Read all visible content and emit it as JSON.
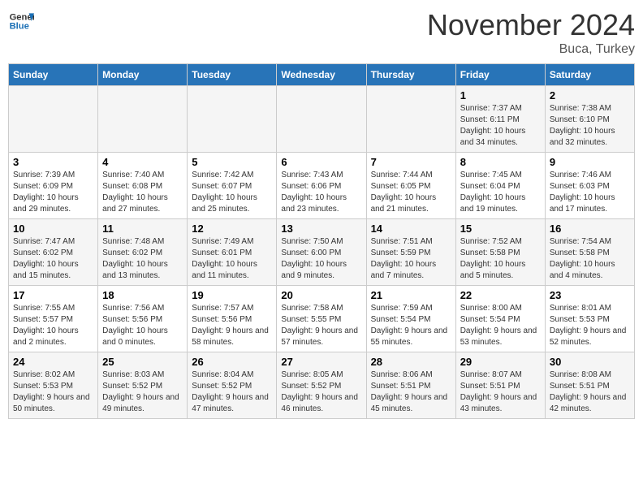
{
  "logo": {
    "line1": "General",
    "line2": "Blue"
  },
  "title": "November 2024",
  "subtitle": "Buca, Turkey",
  "days_of_week": [
    "Sunday",
    "Monday",
    "Tuesday",
    "Wednesday",
    "Thursday",
    "Friday",
    "Saturday"
  ],
  "weeks": [
    [
      {
        "day": "",
        "info": ""
      },
      {
        "day": "",
        "info": ""
      },
      {
        "day": "",
        "info": ""
      },
      {
        "day": "",
        "info": ""
      },
      {
        "day": "",
        "info": ""
      },
      {
        "day": "1",
        "info": "Sunrise: 7:37 AM\nSunset: 6:11 PM\nDaylight: 10 hours and 34 minutes."
      },
      {
        "day": "2",
        "info": "Sunrise: 7:38 AM\nSunset: 6:10 PM\nDaylight: 10 hours and 32 minutes."
      }
    ],
    [
      {
        "day": "3",
        "info": "Sunrise: 7:39 AM\nSunset: 6:09 PM\nDaylight: 10 hours and 29 minutes."
      },
      {
        "day": "4",
        "info": "Sunrise: 7:40 AM\nSunset: 6:08 PM\nDaylight: 10 hours and 27 minutes."
      },
      {
        "day": "5",
        "info": "Sunrise: 7:42 AM\nSunset: 6:07 PM\nDaylight: 10 hours and 25 minutes."
      },
      {
        "day": "6",
        "info": "Sunrise: 7:43 AM\nSunset: 6:06 PM\nDaylight: 10 hours and 23 minutes."
      },
      {
        "day": "7",
        "info": "Sunrise: 7:44 AM\nSunset: 6:05 PM\nDaylight: 10 hours and 21 minutes."
      },
      {
        "day": "8",
        "info": "Sunrise: 7:45 AM\nSunset: 6:04 PM\nDaylight: 10 hours and 19 minutes."
      },
      {
        "day": "9",
        "info": "Sunrise: 7:46 AM\nSunset: 6:03 PM\nDaylight: 10 hours and 17 minutes."
      }
    ],
    [
      {
        "day": "10",
        "info": "Sunrise: 7:47 AM\nSunset: 6:02 PM\nDaylight: 10 hours and 15 minutes."
      },
      {
        "day": "11",
        "info": "Sunrise: 7:48 AM\nSunset: 6:02 PM\nDaylight: 10 hours and 13 minutes."
      },
      {
        "day": "12",
        "info": "Sunrise: 7:49 AM\nSunset: 6:01 PM\nDaylight: 10 hours and 11 minutes."
      },
      {
        "day": "13",
        "info": "Sunrise: 7:50 AM\nSunset: 6:00 PM\nDaylight: 10 hours and 9 minutes."
      },
      {
        "day": "14",
        "info": "Sunrise: 7:51 AM\nSunset: 5:59 PM\nDaylight: 10 hours and 7 minutes."
      },
      {
        "day": "15",
        "info": "Sunrise: 7:52 AM\nSunset: 5:58 PM\nDaylight: 10 hours and 5 minutes."
      },
      {
        "day": "16",
        "info": "Sunrise: 7:54 AM\nSunset: 5:58 PM\nDaylight: 10 hours and 4 minutes."
      }
    ],
    [
      {
        "day": "17",
        "info": "Sunrise: 7:55 AM\nSunset: 5:57 PM\nDaylight: 10 hours and 2 minutes."
      },
      {
        "day": "18",
        "info": "Sunrise: 7:56 AM\nSunset: 5:56 PM\nDaylight: 10 hours and 0 minutes."
      },
      {
        "day": "19",
        "info": "Sunrise: 7:57 AM\nSunset: 5:56 PM\nDaylight: 9 hours and 58 minutes."
      },
      {
        "day": "20",
        "info": "Sunrise: 7:58 AM\nSunset: 5:55 PM\nDaylight: 9 hours and 57 minutes."
      },
      {
        "day": "21",
        "info": "Sunrise: 7:59 AM\nSunset: 5:54 PM\nDaylight: 9 hours and 55 minutes."
      },
      {
        "day": "22",
        "info": "Sunrise: 8:00 AM\nSunset: 5:54 PM\nDaylight: 9 hours and 53 minutes."
      },
      {
        "day": "23",
        "info": "Sunrise: 8:01 AM\nSunset: 5:53 PM\nDaylight: 9 hours and 52 minutes."
      }
    ],
    [
      {
        "day": "24",
        "info": "Sunrise: 8:02 AM\nSunset: 5:53 PM\nDaylight: 9 hours and 50 minutes."
      },
      {
        "day": "25",
        "info": "Sunrise: 8:03 AM\nSunset: 5:52 PM\nDaylight: 9 hours and 49 minutes."
      },
      {
        "day": "26",
        "info": "Sunrise: 8:04 AM\nSunset: 5:52 PM\nDaylight: 9 hours and 47 minutes."
      },
      {
        "day": "27",
        "info": "Sunrise: 8:05 AM\nSunset: 5:52 PM\nDaylight: 9 hours and 46 minutes."
      },
      {
        "day": "28",
        "info": "Sunrise: 8:06 AM\nSunset: 5:51 PM\nDaylight: 9 hours and 45 minutes."
      },
      {
        "day": "29",
        "info": "Sunrise: 8:07 AM\nSunset: 5:51 PM\nDaylight: 9 hours and 43 minutes."
      },
      {
        "day": "30",
        "info": "Sunrise: 8:08 AM\nSunset: 5:51 PM\nDaylight: 9 hours and 42 minutes."
      }
    ]
  ]
}
